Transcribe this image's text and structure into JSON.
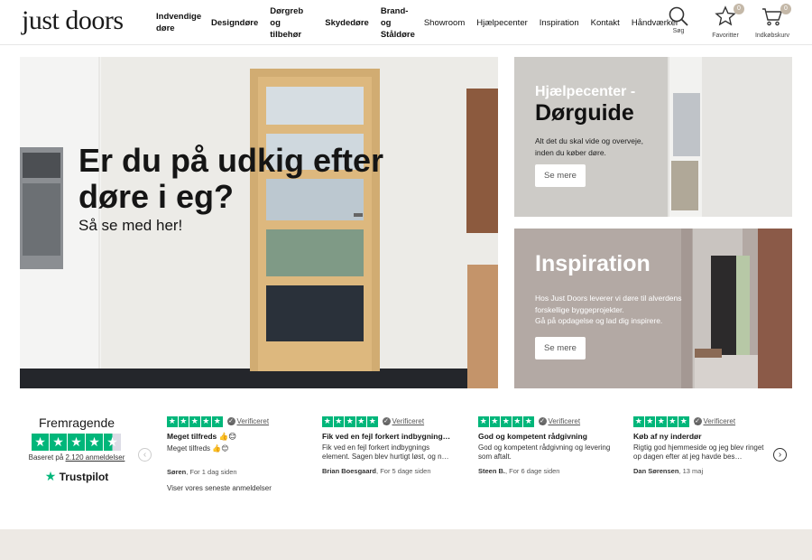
{
  "header": {
    "logo": "just doors",
    "nav": [
      {
        "label": "Indvendige døre",
        "bold": true
      },
      {
        "label": "Designdøre",
        "bold": true
      },
      {
        "label": "Dørgreb og tilbehør",
        "bold": true
      },
      {
        "label": "Skydedøre",
        "bold": true
      },
      {
        "label": "Brand- og Ståldøre",
        "bold": true
      },
      {
        "label": "Showroom",
        "bold": false
      },
      {
        "label": "Hjælpecenter",
        "bold": false
      },
      {
        "label": "Inspiration",
        "bold": false
      },
      {
        "label": "Kontakt",
        "bold": false
      },
      {
        "label": "Håndværker",
        "bold": false
      }
    ],
    "search_label": "Søg",
    "favorites_label": "Favoritter",
    "favorites_count": "0",
    "cart_label": "Indkøbskurv",
    "cart_count": "0"
  },
  "hero": {
    "title": "Er du på udkig efter døre i eg?",
    "subtitle": "Så se med her!"
  },
  "cards": {
    "help": {
      "title_line1": "Hjælpecenter -",
      "title_line2": "Dørguide",
      "text": "Alt det du skal vide og overveje, inden du køber døre.",
      "button": "Se mere"
    },
    "inspiration": {
      "title": "Inspiration",
      "text_line1": "Hos Just Doors leverer vi døre til alverdens forskellige byggeprojekter.",
      "text_line2": "Gå på opdagelse og lad dig inspirere.",
      "button": "Se mere"
    }
  },
  "trustpilot": {
    "rating_word": "Fremragende",
    "stars": 4.5,
    "based_prefix": "Baseret på",
    "review_count": "2.120 anmeldelser",
    "brand": "Trustpilot"
  },
  "reviews": [
    {
      "verified": "Verificeret",
      "title": "Meget tilfreds 👍😊",
      "body": "Meget tilfreds 👍😊",
      "author": "Søren",
      "time": ", For 1 dag siden"
    },
    {
      "verified": "Verificeret",
      "title": "Fik ved en fejl forkert indbygning…",
      "body": "Fik ved en fejl forkert indbygnings element. Sagen blev hurtigt løst, og n…",
      "author": "Brian Boesgaard",
      "time": ", For 5 dage siden"
    },
    {
      "verified": "Verificeret",
      "title": "God og kompetent rådgivning",
      "body": "God og kompetent rådgivning og levering som aftalt.",
      "author": "Steen B.",
      "time": ", For 6 dage siden"
    },
    {
      "verified": "Verificeret",
      "title": "Køb af ny inderdør",
      "body": "Rigtig god hjemmeside og jeg blev ringet op dagen efter at jeg havde bes…",
      "author": "Dan Sørensen",
      "time": ", 13 maj"
    }
  ],
  "see_latest": "Viser vores seneste anmeldelser"
}
